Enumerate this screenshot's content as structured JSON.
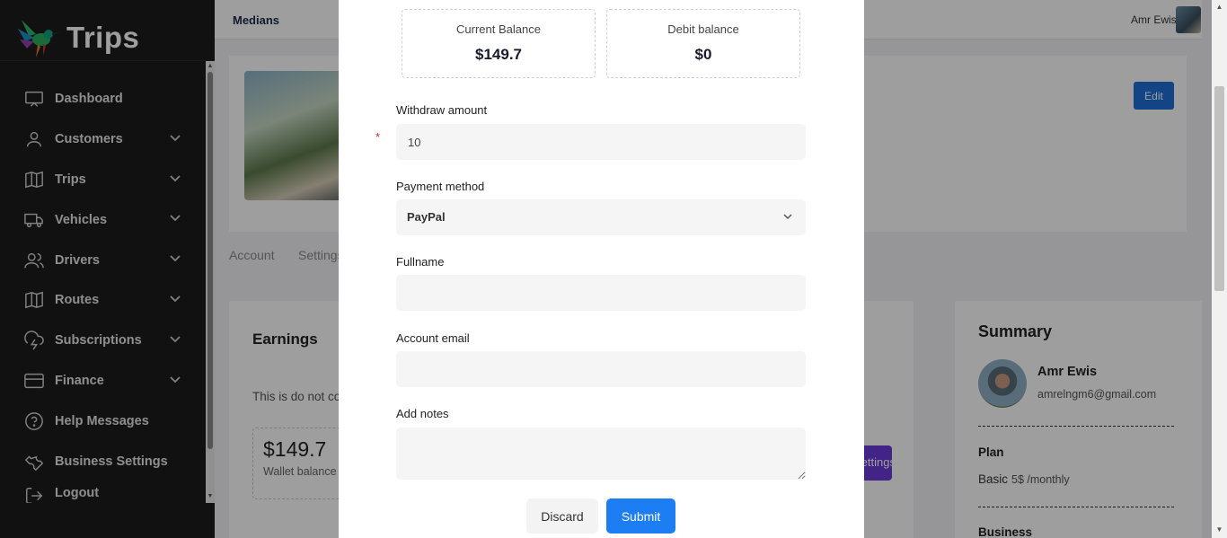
{
  "sidebar": {
    "logo_text": "Trips",
    "items": [
      {
        "label": "Dashboard",
        "icon": "monitor-icon",
        "has_chevron": false
      },
      {
        "label": "Customers",
        "icon": "user-icon",
        "has_chevron": true
      },
      {
        "label": "Trips",
        "icon": "map-icon",
        "has_chevron": true
      },
      {
        "label": "Vehicles",
        "icon": "truck-icon",
        "has_chevron": true
      },
      {
        "label": "Drivers",
        "icon": "users-icon",
        "has_chevron": true
      },
      {
        "label": "Routes",
        "icon": "map-icon",
        "has_chevron": true
      },
      {
        "label": "Subscriptions",
        "icon": "cloud-lightning-icon",
        "has_chevron": true
      },
      {
        "label": "Finance",
        "icon": "credit-card-icon",
        "has_chevron": true
      },
      {
        "label": "Help Messages",
        "icon": "help-circle-icon",
        "has_chevron": false
      },
      {
        "label": "Business Settings",
        "icon": "wrench-icon",
        "has_chevron": false
      },
      {
        "label": "Logout",
        "icon": "logout-icon",
        "has_chevron": false
      }
    ]
  },
  "topbar": {
    "title": "Medians",
    "user_name": "Amr Ewis"
  },
  "profile": {
    "edit_label": "Edit",
    "tabs": [
      "Account",
      "Settings"
    ]
  },
  "earnings": {
    "title": "Earnings",
    "description": "This is do not co",
    "wallet_amount": "$149.7",
    "wallet_label": "Wallet balance",
    "button_label": "Settings"
  },
  "summary": {
    "title": "Summary",
    "name": "Amr Ewis",
    "email": "amrelngm6@gmail.com",
    "plan_label": "Plan",
    "plan_name": "Basic",
    "plan_price": "5$ /monthly",
    "business_label": "Business"
  },
  "modal": {
    "current_balance_label": "Current Balance",
    "current_balance_value": "$149.7",
    "debit_balance_label": "Debit balance",
    "debit_balance_value": "$0",
    "withdraw_label": "Withdraw amount",
    "withdraw_required_mark": "*",
    "withdraw_value": "10",
    "payment_label": "Payment method",
    "payment_value": "PayPal",
    "fullname_label": "Fullname",
    "fullname_value": "",
    "email_label": "Account email",
    "email_value": "",
    "notes_label": "Add notes",
    "discard_label": "Discard",
    "submit_label": "Submit"
  },
  "colors": {
    "sidebar_bg": "#1c1c1e",
    "primary": "#1c7ef2",
    "edit_button": "#1e6fd9",
    "purple_button": "#6a3bd8",
    "required": "#e02424"
  }
}
